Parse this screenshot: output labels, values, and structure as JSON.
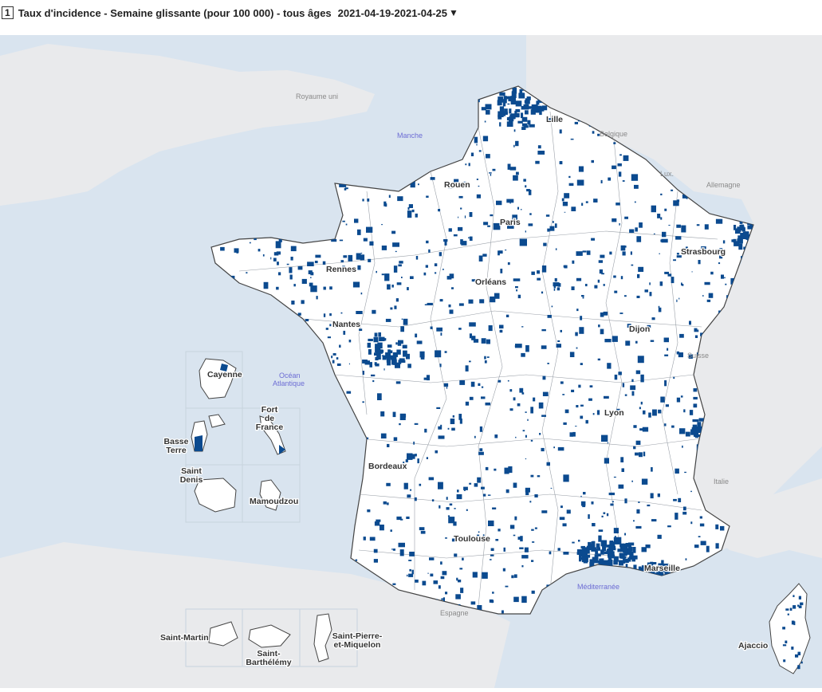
{
  "header": {
    "index": "1",
    "title": "Taux d'incidence - Semaine glissante (pour 100 000) - tous âges",
    "period": "2021-04-19-2021-04-25",
    "dropdown_icon": "caret-down-icon"
  },
  "map": {
    "colors": {
      "sea": "#d9e4ef",
      "land_other": "#e9eaec",
      "france": "#ffffff",
      "hotspot": "#0b4a8f",
      "border": "#444444",
      "inset_frame": "#b9c4d0"
    },
    "cities": [
      {
        "id": "lille",
        "label": "Lille"
      },
      {
        "id": "rouen",
        "label": "Rouen"
      },
      {
        "id": "paris",
        "label": "Paris"
      },
      {
        "id": "strasbourg",
        "label": "Strasbourg"
      },
      {
        "id": "rennes",
        "label": "Rennes"
      },
      {
        "id": "orleans",
        "label": "Orléans"
      },
      {
        "id": "nantes",
        "label": "Nantes"
      },
      {
        "id": "dijon",
        "label": "Dijon"
      },
      {
        "id": "lyon",
        "label": "Lyon"
      },
      {
        "id": "bordeaux",
        "label": "Bordeaux"
      },
      {
        "id": "toulouse",
        "label": "Toulouse"
      },
      {
        "id": "marseille",
        "label": "Marseille"
      },
      {
        "id": "ajaccio",
        "label": "Ajaccio"
      }
    ],
    "countries": [
      {
        "id": "royaume-uni",
        "label": "Royaume uni"
      },
      {
        "id": "belgique",
        "label": "Belgique"
      },
      {
        "id": "lux",
        "label": "Lux."
      },
      {
        "id": "allemagne",
        "label": "Allemagne"
      },
      {
        "id": "suisse",
        "label": "Suisse"
      },
      {
        "id": "italie",
        "label": "Italie"
      },
      {
        "id": "espagne",
        "label": "Espagne"
      }
    ],
    "seas": [
      {
        "id": "manche",
        "label": "Manche"
      },
      {
        "id": "ocean-1",
        "label": "Océan"
      },
      {
        "id": "ocean-2",
        "label": "Atlantique"
      },
      {
        "id": "mediterranee",
        "label": "Méditerranée"
      }
    ],
    "insets": {
      "cayenne": "Cayenne",
      "fort_de_france": [
        "Fort",
        "de",
        "France"
      ],
      "basse_terre": [
        "Basse",
        "Terre"
      ],
      "saint_denis": [
        "Saint",
        "Denis"
      ],
      "mamoudzou": "Mamoudzou",
      "saint_martin": "Saint-Martin",
      "saint_barthelemy": [
        "Saint-",
        "Barthélémy"
      ],
      "saint_pierre": [
        "Saint-Pierre-",
        "et-Miquelon"
      ]
    }
  }
}
